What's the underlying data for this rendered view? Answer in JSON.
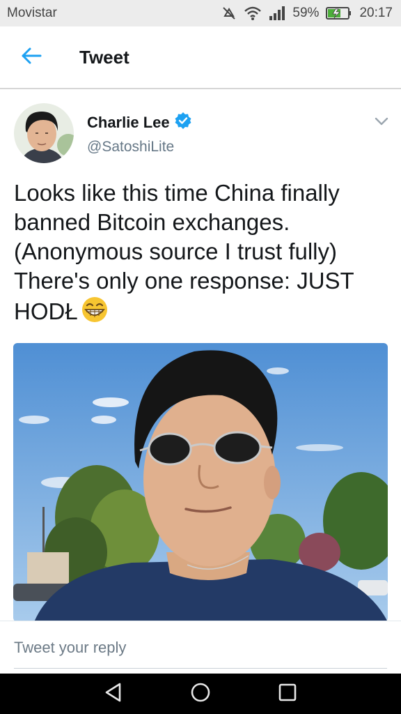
{
  "status_bar": {
    "carrier": "Movistar",
    "battery_percent": "59%",
    "time": "20:17"
  },
  "header": {
    "title": "Tweet"
  },
  "tweet": {
    "author": {
      "display_name": "Charlie Lee",
      "handle": "@SatoshiLite",
      "verified": true
    },
    "text": "Looks like this time China finally banned Bitcoin exchanges. (Anonymous source I trust fully) There's only one response: JUST HODŁ"
  },
  "reply": {
    "placeholder": "Tweet your reply"
  },
  "colors": {
    "accent": "#1da1f2",
    "text_primary": "#14171a",
    "text_secondary": "#657786",
    "status_bar_bg": "#ececec",
    "nav_bar_bg": "#000000"
  },
  "icons": {
    "back": "arrow-left-icon",
    "verified": "verified-badge-icon",
    "caret": "chevron-down-icon",
    "emoji": "grinning-face-emoji"
  }
}
